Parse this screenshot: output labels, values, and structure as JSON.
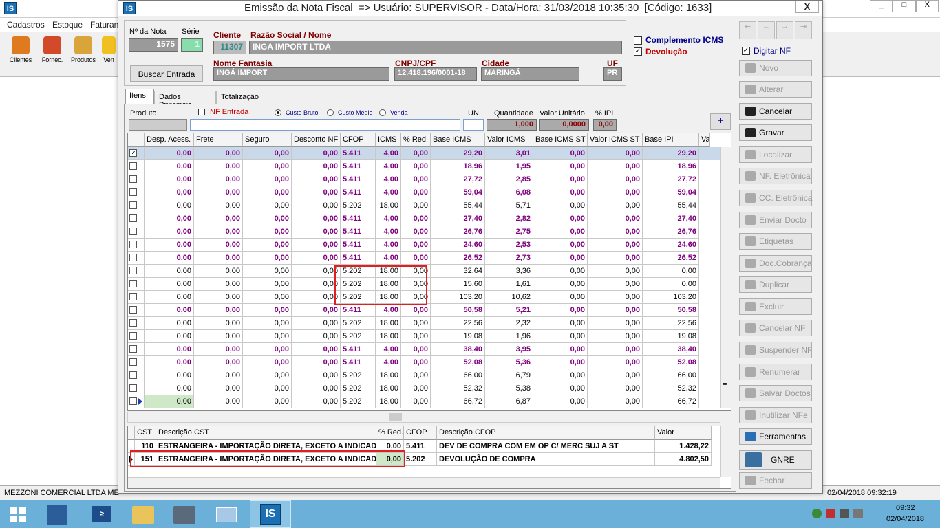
{
  "bg_app": {
    "title_icon": "IS",
    "menu": [
      "Cadastros",
      "Estoque",
      "Faturan"
    ],
    "toolbar": [
      "Clientes",
      "Fornec.",
      "Produtos",
      "Ven"
    ],
    "status_company": "MEZZONI COMERCIAL LTDA ME",
    "status_datetime": "02/04/2018 09:32:19",
    "win_buttons": [
      "_",
      "□",
      "X"
    ]
  },
  "window": {
    "title": "Emissão da Nota Fiscal  => Usuário: SUPERVISOR - Data/Hora: 31/03/2018 10:35:30  [Código: 1633]",
    "close": "X"
  },
  "header": {
    "nota_label": "Nº da Nota",
    "nota": "1575",
    "serie_label": "Série",
    "serie": "1",
    "buscar": "Buscar Entrada",
    "cliente_label": "Cliente",
    "cliente": "11307",
    "razao_label": "Razão Social / Nome",
    "razao": "INGA IMPORT LTDA",
    "fantasia_label": "Nome Fantasia",
    "fantasia": "INGÁ IMPORT",
    "cnpj_label": "CNPJ/CPF",
    "cnpj": "12.418.196/0001-18",
    "cidade_label": "Cidade",
    "cidade": "MARINGÁ",
    "uf_label": "UF",
    "uf": "PR",
    "complemento": "Complemento ICMS",
    "devolucao": "Devolução"
  },
  "tabs": [
    "Itens",
    "Dados Principais",
    "Totalização"
  ],
  "produto_bar": {
    "produto": "Produto",
    "nf_entrada": "NF Entrada",
    "custo_bruto": "Custo Bruto",
    "custo_medio": "Custo Médio",
    "venda": "Venda",
    "un": "UN",
    "quantidade": "Quantidade",
    "qtd_val": "1,000",
    "valor_unit": "Valor Unitário",
    "vu_val": "0,0000",
    "ipi": "% IPI",
    "ipi_val": "0,00",
    "add": "+"
  },
  "grid": {
    "headers": [
      "Desp. Acess.",
      "Frete",
      "Seguro",
      "Desconto NF",
      "CFOP",
      "ICMS",
      "% Red.",
      "Base ICMS",
      "Valor ICMS",
      "Base ICMS ST",
      "Valor ICMS ST",
      "Base IPI",
      "Valor"
    ],
    "rows": [
      [
        "0,00",
        "0,00",
        "0,00",
        "0,00",
        "5.411",
        "4,00",
        "0,00",
        "29,20",
        "3,01",
        "0,00",
        "0,00",
        "29,20"
      ],
      [
        "0,00",
        "0,00",
        "0,00",
        "0,00",
        "5.411",
        "4,00",
        "0,00",
        "18,96",
        "1,95",
        "0,00",
        "0,00",
        "18,96"
      ],
      [
        "0,00",
        "0,00",
        "0,00",
        "0,00",
        "5.411",
        "4,00",
        "0,00",
        "27,72",
        "2,85",
        "0,00",
        "0,00",
        "27,72"
      ],
      [
        "0,00",
        "0,00",
        "0,00",
        "0,00",
        "5.411",
        "4,00",
        "0,00",
        "59,04",
        "6,08",
        "0,00",
        "0,00",
        "59,04"
      ],
      [
        "0,00",
        "0,00",
        "0,00",
        "0,00",
        "5.202",
        "18,00",
        "0,00",
        "55,44",
        "5,71",
        "0,00",
        "0,00",
        "55,44"
      ],
      [
        "0,00",
        "0,00",
        "0,00",
        "0,00",
        "5.411",
        "4,00",
        "0,00",
        "27,40",
        "2,82",
        "0,00",
        "0,00",
        "27,40"
      ],
      [
        "0,00",
        "0,00",
        "0,00",
        "0,00",
        "5.411",
        "4,00",
        "0,00",
        "26,76",
        "2,75",
        "0,00",
        "0,00",
        "26,76"
      ],
      [
        "0,00",
        "0,00",
        "0,00",
        "0,00",
        "5.411",
        "4,00",
        "0,00",
        "24,60",
        "2,53",
        "0,00",
        "0,00",
        "24,60"
      ],
      [
        "0,00",
        "0,00",
        "0,00",
        "0,00",
        "5.411",
        "4,00",
        "0,00",
        "26,52",
        "2,73",
        "0,00",
        "0,00",
        "26,52"
      ],
      [
        "0,00",
        "0,00",
        "0,00",
        "0,00",
        "5.202",
        "18,00",
        "0,00",
        "32,64",
        "3,36",
        "0,00",
        "0,00",
        "0,00"
      ],
      [
        "0,00",
        "0,00",
        "0,00",
        "0,00",
        "5.202",
        "18,00",
        "0,00",
        "15,60",
        "1,61",
        "0,00",
        "0,00",
        "0,00"
      ],
      [
        "0,00",
        "0,00",
        "0,00",
        "0,00",
        "5.202",
        "18,00",
        "0,00",
        "103,20",
        "10,62",
        "0,00",
        "0,00",
        "103,20"
      ],
      [
        "0,00",
        "0,00",
        "0,00",
        "0,00",
        "5.411",
        "4,00",
        "0,00",
        "50,58",
        "5,21",
        "0,00",
        "0,00",
        "50,58"
      ],
      [
        "0,00",
        "0,00",
        "0,00",
        "0,00",
        "5.202",
        "18,00",
        "0,00",
        "22,56",
        "2,32",
        "0,00",
        "0,00",
        "22,56"
      ],
      [
        "0,00",
        "0,00",
        "0,00",
        "0,00",
        "5.202",
        "18,00",
        "0,00",
        "19,08",
        "1,96",
        "0,00",
        "0,00",
        "19,08"
      ],
      [
        "0,00",
        "0,00",
        "0,00",
        "0,00",
        "5.411",
        "4,00",
        "0,00",
        "38,40",
        "3,95",
        "0,00",
        "0,00",
        "38,40"
      ],
      [
        "0,00",
        "0,00",
        "0,00",
        "0,00",
        "5.411",
        "4,00",
        "0,00",
        "52,08",
        "5,36",
        "0,00",
        "0,00",
        "52,08"
      ],
      [
        "0,00",
        "0,00",
        "0,00",
        "0,00",
        "5.202",
        "18,00",
        "0,00",
        "66,00",
        "6,79",
        "0,00",
        "0,00",
        "66,00"
      ],
      [
        "0,00",
        "0,00",
        "0,00",
        "0,00",
        "5.202",
        "18,00",
        "0,00",
        "52,32",
        "5,38",
        "0,00",
        "0,00",
        "52,32"
      ],
      [
        "0,00",
        "0,00",
        "0,00",
        "0,00",
        "5.202",
        "18,00",
        "0,00",
        "66,72",
        "6,87",
        "0,00",
        "0,00",
        "66,72"
      ]
    ]
  },
  "grid2": {
    "headers": [
      "CST",
      "Descrição CST",
      "% Red.",
      "CFOP",
      "Descrição CFOP",
      "Valor"
    ],
    "rows": [
      [
        "110",
        "ESTRANGEIRA - IMPORTAÇÃO DIRETA, EXCETO A INDICADA N",
        "0,00",
        "5.411",
        "DEV DE COMPRA COM EM OP C/ MERC SUJ A ST",
        "1.428,22"
      ],
      [
        "151",
        "ESTRANGEIRA - IMPORTAÇÃO DIRETA, EXCETO A INDICADA N",
        "0,00",
        "5.202",
        "DEVOLUÇÃO DE COMPRA",
        "4.802,50"
      ]
    ]
  },
  "right_panel": {
    "digitar": "Digitar NF",
    "buttons": [
      "Novo",
      "Alterar",
      "Cancelar",
      "Gravar",
      "Localizar",
      "NF. Eletrônica",
      "CC. Eletrônica",
      "Enviar Docto",
      "Etiquetas",
      "Doc.Cobrança",
      "Duplicar",
      "Excluir",
      "Cancelar NF",
      "Suspender NF",
      "Renumerar",
      "Salvar Doctos",
      "Inutilizar NFe",
      "Ferramentas",
      "GNRE",
      "Fechar"
    ]
  },
  "taskbar": {
    "time": "09:32",
    "date": "02/04/2018"
  }
}
